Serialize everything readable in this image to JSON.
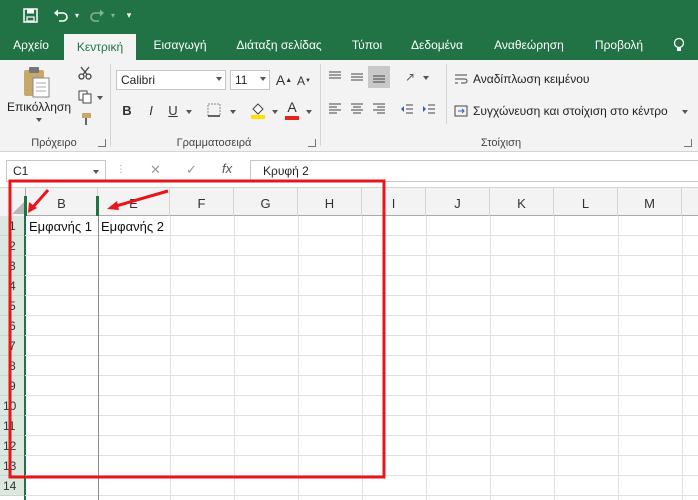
{
  "colors": {
    "accent": "#217346",
    "annotation": "#e8151b",
    "font_color_bar": "#e2231a",
    "highlight_bar": "#ffe000"
  },
  "qat": {
    "save_icon": "save-icon",
    "undo_icon": "undo-icon",
    "redo_icon": "redo-icon",
    "customize_icon": "customize-qat-icon"
  },
  "tabs": [
    {
      "label": "Αρχείο"
    },
    {
      "label": "Κεντρική"
    },
    {
      "label": "Εισαγωγή"
    },
    {
      "label": "Διάταξη σελίδας"
    },
    {
      "label": "Τύποι"
    },
    {
      "label": "Δεδομένα"
    },
    {
      "label": "Αναθεώρηση"
    },
    {
      "label": "Προβολή"
    }
  ],
  "active_tab": "Κεντρική",
  "ribbon": {
    "clipboard": {
      "paste_label": "Επικόλληση",
      "group_label": "Πρόχειρο"
    },
    "font": {
      "font_name": "Calibri",
      "font_size": "11",
      "group_label": "Γραμματοσειρά",
      "bold": "B",
      "italic": "I",
      "underline": "U",
      "grow": "A",
      "shrink": "A",
      "font_color": "A"
    },
    "alignment": {
      "wrap_text": "Αναδίπλωση κειμένου",
      "merge_center": "Συγχώνευση και στοίχιση στο κέντρο",
      "group_label": "Στοίχιση"
    }
  },
  "formula_bar": {
    "name_box": "C1",
    "cancel": "✕",
    "enter": "✓",
    "fx": "fx",
    "content": "Κρυφή 2"
  },
  "grid": {
    "columns": [
      "B",
      "E",
      "F",
      "G",
      "H",
      "I",
      "J",
      "K",
      "L",
      "M"
    ],
    "rows": [
      "1",
      "2",
      "3",
      "4",
      "5",
      "6",
      "7",
      "8",
      "9",
      "10",
      "11",
      "12",
      "13",
      "14"
    ],
    "cells": {
      "B1": "Εμφανής 1",
      "E1": "Εμφανής 2"
    }
  }
}
